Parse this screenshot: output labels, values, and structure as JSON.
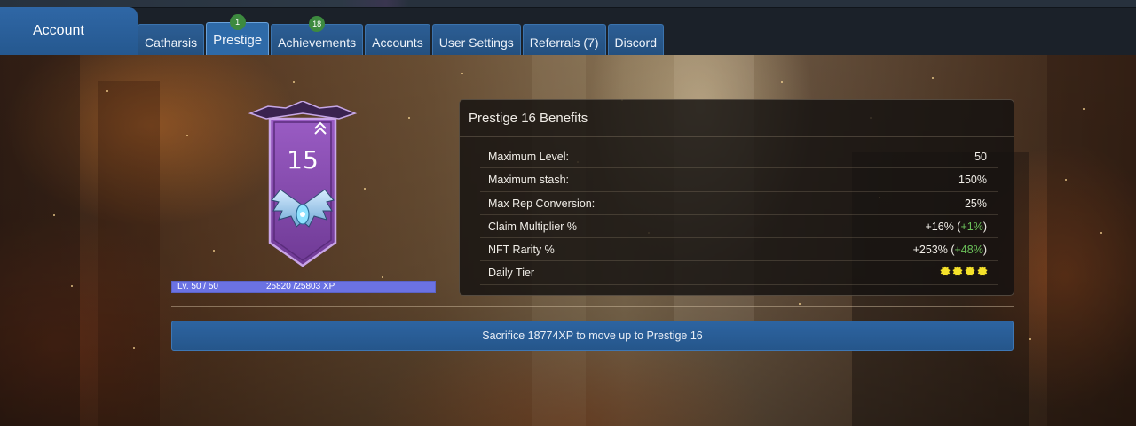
{
  "header": {
    "account_label": "Account",
    "tabs": [
      {
        "label": "Catharsis",
        "badge": null,
        "active": false
      },
      {
        "label": "Prestige",
        "badge": "1",
        "active": true
      },
      {
        "label": "Achievements",
        "badge": "18",
        "active": false
      },
      {
        "label": "Accounts",
        "badge": null,
        "active": false
      },
      {
        "label": "User Settings",
        "badge": null,
        "active": false
      },
      {
        "label": "Referrals (7)",
        "badge": null,
        "active": false
      },
      {
        "label": "Discord",
        "badge": null,
        "active": false
      }
    ]
  },
  "prestige": {
    "current": "15",
    "level_text": "Lv. 50 / 50",
    "xp_text": "25820 /25803 XP",
    "progress_fraction": 1.0
  },
  "benefits": {
    "title": "Prestige 16 Benefits",
    "rows": [
      {
        "label": "Maximum Level:",
        "value": "50",
        "bonus": null
      },
      {
        "label": "Maximum stash:",
        "value": "150%",
        "bonus": null
      },
      {
        "label": "Max Rep Conversion:",
        "value": "25%",
        "bonus": null
      },
      {
        "label": "Claim Multiplier %",
        "value": "+16% (",
        "bonus": "+1%",
        "close": ")"
      },
      {
        "label": "NFT Rarity %",
        "value": "+253% (",
        "bonus": "+48%",
        "close": ")"
      },
      {
        "label": "Daily Tier",
        "stars": 4
      }
    ]
  },
  "action": {
    "label": "Sacrifice 18774XP to move up to Prestige 16"
  },
  "colors": {
    "primary_blue": "#2e6aa8",
    "badge_green": "#3d8a3f",
    "bonus_green": "#6bc15a",
    "banner_purple": "#8b4fb0",
    "progress_fill": "#6b72e3",
    "star_yellow": "#f5e12a"
  }
}
